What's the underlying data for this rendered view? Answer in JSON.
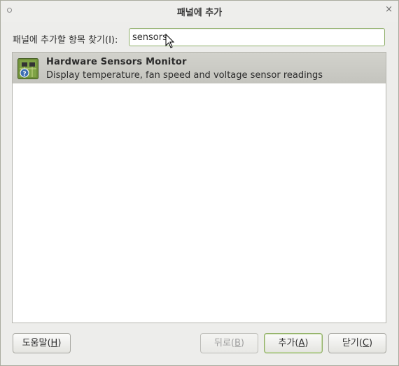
{
  "window": {
    "title": "패널에 추가",
    "close_glyph": "×"
  },
  "search": {
    "label": "패널에 추가할 항목 찾기(I):",
    "value": "sensors"
  },
  "results": [
    {
      "title": "Hardware Sensors Monitor",
      "description": "Display temperature, fan speed and voltage sensor readings",
      "icon": "hardware-sensors-icon",
      "selected": true
    }
  ],
  "buttons": {
    "help": {
      "text": "도움말",
      "mnemonic": "H"
    },
    "back": {
      "text": "뒤로",
      "mnemonic": "B",
      "enabled": false
    },
    "add": {
      "text": "추가",
      "mnemonic": "A"
    },
    "close": {
      "text": "닫기",
      "mnemonic": "C"
    }
  },
  "colors": {
    "accent": "#8fae64",
    "selection": "#c8c8c2"
  }
}
